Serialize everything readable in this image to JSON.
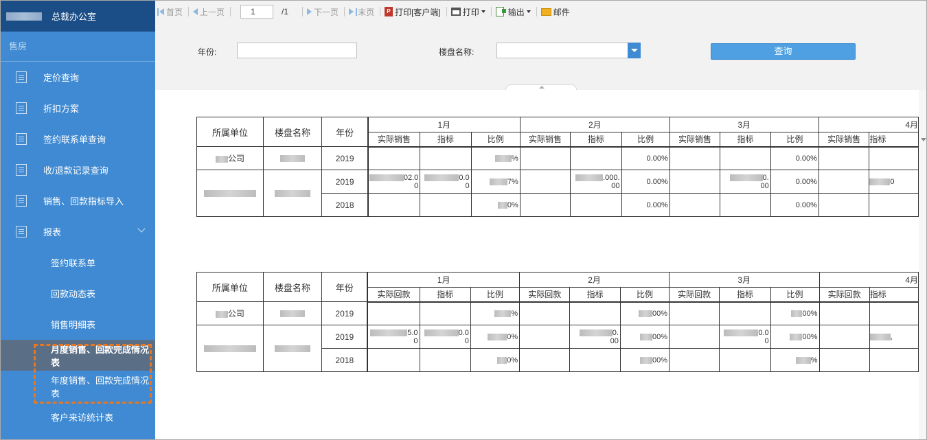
{
  "sidebar": {
    "org_title": "总裁办公室",
    "section": "售房",
    "items": [
      {
        "label": "定价查询"
      },
      {
        "label": "折扣方案"
      },
      {
        "label": "签约联系单查询"
      },
      {
        "label": "收/退款记录查询"
      },
      {
        "label": "销售、回款指标导入"
      },
      {
        "label": "报表"
      }
    ],
    "subitems": [
      {
        "label": "签约联系单"
      },
      {
        "label": "回款动态表"
      },
      {
        "label": "销售明细表"
      },
      {
        "label": "月度销售、回款完成情况表",
        "active": true
      },
      {
        "label": "年度销售、回款完成情况表"
      },
      {
        "label": "客户来访统计表"
      }
    ]
  },
  "toolbar": {
    "first": "首页",
    "prev": "上一页",
    "page_value": "1",
    "page_total": "/1",
    "next": "下一页",
    "last": "末页",
    "print_client": "打印[客户端]",
    "print": "打印",
    "export": "输出",
    "mail": "邮件"
  },
  "filter": {
    "year_label": "年份:",
    "year_value": "",
    "project_label": "楼盘名称:",
    "project_value": "",
    "query_button": "查询"
  },
  "tables": [
    {
      "headers": {
        "unit": "所属单位",
        "project": "楼盘名称",
        "year": "年份"
      },
      "months": [
        "1月",
        "2月",
        "3月",
        "4月"
      ],
      "sub_headers": [
        "实际销售",
        "指标",
        "比例"
      ],
      "rows": [
        {
          "unit": "公司",
          "year": "2019",
          "m1": [
            "",
            "",
            "%"
          ],
          "m2": [
            "",
            "",
            "0.00%"
          ],
          "m3": [
            "",
            "",
            "0.00%"
          ],
          "m4": [
            "",
            ""
          ]
        },
        {
          "unit": "",
          "year": "2019",
          "m1": [
            "02.0\n0",
            "0.0\n0",
            "7%"
          ],
          "m2": [
            "",
            ".000.\n00",
            "0.00%"
          ],
          "m3": [
            "",
            "0.\n00",
            "0.00%"
          ],
          "m4": [
            "",
            "0"
          ]
        },
        {
          "unit": "",
          "year": "2018",
          "m1": [
            "",
            "",
            "0%"
          ],
          "m2": [
            "",
            "",
            "0.00%"
          ],
          "m3": [
            "",
            "",
            "0.00%"
          ],
          "m4": [
            "",
            ""
          ]
        }
      ]
    },
    {
      "headers": {
        "unit": "所属单位",
        "project": "楼盘名称",
        "year": "年份"
      },
      "months": [
        "1月",
        "2月",
        "3月",
        "4月"
      ],
      "sub_headers": [
        "实际回款",
        "指标",
        "比例"
      ],
      "rows": [
        {
          "unit": "公司",
          "year": "2019",
          "m1": [
            "",
            "",
            "%"
          ],
          "m2": [
            "",
            "",
            "00%"
          ],
          "m3": [
            "",
            "",
            "00%"
          ],
          "m4": [
            "",
            ""
          ]
        },
        {
          "unit": "",
          "year": "2019",
          "m1": [
            "5.0\n0",
            "0.0\n0",
            "0%"
          ],
          "m2": [
            "",
            "0.\n00",
            "00%"
          ],
          "m3": [
            "",
            "0.0\n0",
            "00%"
          ],
          "m4": [
            "",
            ","
          ]
        },
        {
          "unit": "",
          "year": "2018",
          "m1": [
            "",
            "",
            "0%"
          ],
          "m2": [
            "",
            "",
            "00%"
          ],
          "m3": [
            "",
            "",
            "%"
          ],
          "m4": [
            "",
            ""
          ]
        }
      ]
    }
  ]
}
